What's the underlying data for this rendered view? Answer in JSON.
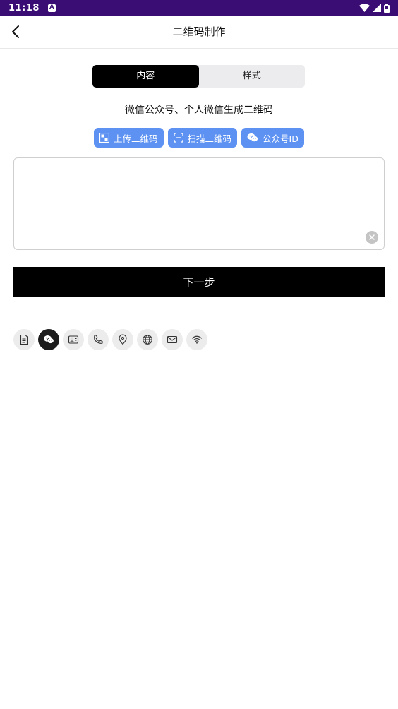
{
  "status_bar": {
    "time": "11:18"
  },
  "app_bar": {
    "title": "二维码制作"
  },
  "tabs": {
    "content": "内容",
    "style": "样式"
  },
  "subtitle": "微信公众号、个人微信生成二维码",
  "chips": {
    "upload": "上传二维码",
    "scan": "扫描二维码",
    "official_id": "公众号ID"
  },
  "input": {
    "value": "",
    "placeholder": ""
  },
  "next_button": "下一步",
  "type_icons": [
    "document-icon",
    "wechat-icon",
    "business-card-icon",
    "phone-icon",
    "location-icon",
    "globe-icon",
    "mail-icon",
    "wifi-icon"
  ],
  "colors": {
    "status_bar": "#3a0d74",
    "accent_chip": "#5d92f2",
    "primary": "#000000"
  }
}
